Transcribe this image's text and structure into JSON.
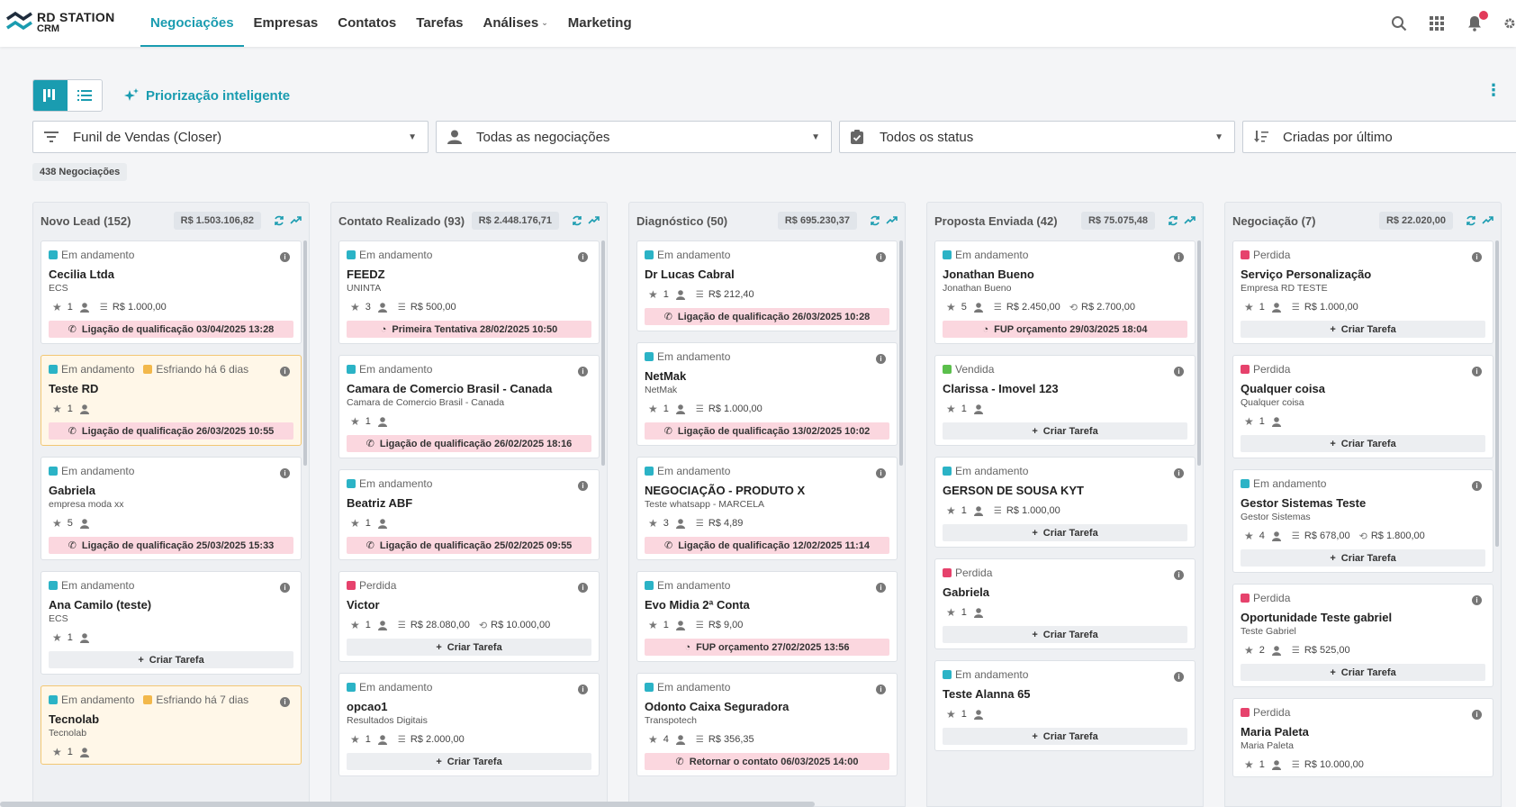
{
  "brand": {
    "line1": "RD STATION",
    "line2": "CRM"
  },
  "nav": [
    "Negociações",
    "Empresas",
    "Contatos",
    "Tarefas",
    "Análises",
    "Marketing"
  ],
  "smart_label": "Priorização inteligente",
  "filters": {
    "funnel": "Funil de Vendas (Closer)",
    "owner": "Todas as negociações",
    "status": "Todos os status",
    "sort": "Criadas por último"
  },
  "deal_count": "438 Negociações",
  "create_task": "Criar Tarefa",
  "columns": [
    {
      "title": "Novo Lead (152)",
      "value": "R$ 1.503.106,82",
      "cards": [
        {
          "status": "Em andamento",
          "color": "blue",
          "name": "Cecilia Ltda",
          "sub": "ECS",
          "stars": "1",
          "amount": "R$ 1.000,00",
          "task": "Ligação de qualificação 03/04/2025 13:28",
          "task_type": "phone"
        },
        {
          "status": "Em andamento",
          "color": "blue",
          "extra": "Esfriando há 6 dias",
          "warm": true,
          "name": "Teste RD",
          "sub": "",
          "stars": "1",
          "task": "Ligação de qualificação 26/03/2025 10:55",
          "task_type": "phone"
        },
        {
          "status": "Em andamento",
          "color": "blue",
          "name": "Gabriela",
          "sub": "empresa moda xx",
          "stars": "5",
          "task": "Ligação de qualificação 25/03/2025 15:33",
          "task_type": "phone"
        },
        {
          "status": "Em andamento",
          "color": "blue",
          "name": "Ana Camilo (teste)",
          "sub": "ECS",
          "stars": "1",
          "task": "",
          "task_type": "create"
        },
        {
          "status": "Em andamento",
          "color": "blue",
          "extra": "Esfriando há 7 dias",
          "warm": true,
          "name": "Tecnolab",
          "sub": "Tecnolab",
          "stars": "1",
          "task": "",
          "task_type": "none"
        }
      ]
    },
    {
      "title": "Contato Realizado (93)",
      "value": "R$ 2.448.176,71",
      "cards": [
        {
          "status": "Em andamento",
          "color": "blue",
          "name": "FEEDZ",
          "sub": "UNINTA",
          "stars": "3",
          "amount": "R$ 500,00",
          "task": "Primeira Tentativa 28/02/2025 10:50",
          "task_type": "whatsapp"
        },
        {
          "status": "Em andamento",
          "color": "blue",
          "name": "Camara de Comercio Brasil - Canada",
          "sub": "Camara de Comercio Brasil - Canada",
          "stars": "1",
          "task": "Ligação de qualificação 26/02/2025 18:16",
          "task_type": "phone"
        },
        {
          "status": "Em andamento",
          "color": "blue",
          "name": "Beatriz ABF",
          "sub": "",
          "stars": "1",
          "task": "Ligação de qualificação 25/02/2025 09:55",
          "task_type": "phone"
        },
        {
          "status": "Perdida",
          "color": "red",
          "name": "Victor",
          "sub": "",
          "stars": "1",
          "amount": "R$ 28.080,00",
          "recurring": "R$ 10.000,00",
          "task": "",
          "task_type": "create"
        },
        {
          "status": "Em andamento",
          "color": "blue",
          "name": "opcao1",
          "sub": "Resultados Digitais",
          "stars": "1",
          "amount": "R$ 2.000,00",
          "task": "",
          "task_type": "create"
        }
      ]
    },
    {
      "title": "Diagnóstico (50)",
      "value": "R$ 695.230,37",
      "cards": [
        {
          "status": "Em andamento",
          "color": "blue",
          "name": "Dr Lucas Cabral",
          "sub": "",
          "stars": "1",
          "amount": "R$ 212,40",
          "task": "Ligação de qualificação 26/03/2025 10:28",
          "task_type": "phone"
        },
        {
          "status": "Em andamento",
          "color": "blue",
          "name": "NetMak",
          "sub": "NetMak",
          "stars": "1",
          "amount": "R$ 1.000,00",
          "task": "Ligação de qualificação 13/02/2025 10:02",
          "task_type": "phone"
        },
        {
          "status": "Em andamento",
          "color": "blue",
          "name": "NEGOCIAÇÃO - PRODUTO X",
          "sub": "Teste whatsapp - MARCELA",
          "stars": "3",
          "amount": "R$ 4,89",
          "task": "Ligação de qualificação 12/02/2025 11:14",
          "task_type": "phone"
        },
        {
          "status": "Em andamento",
          "color": "blue",
          "name": "Evo Midia 2ª Conta",
          "sub": "",
          "stars": "1",
          "amount": "R$ 9,00",
          "task": "FUP orçamento 27/02/2025 13:56",
          "task_type": "whatsapp"
        },
        {
          "status": "Em andamento",
          "color": "blue",
          "name": "Odonto Caixa Seguradora",
          "sub": "Transpotech",
          "stars": "4",
          "amount": "R$ 356,35",
          "task": "Retornar o contato 06/03/2025 14:00",
          "task_type": "phone"
        }
      ]
    },
    {
      "title": "Proposta Enviada (42)",
      "value": "R$ 75.075,48",
      "cards": [
        {
          "status": "Em andamento",
          "color": "blue",
          "name": "Jonathan Bueno",
          "sub": "Jonathan Bueno",
          "stars": "5",
          "amount": "R$ 2.450,00",
          "recurring": "R$ 2.700,00",
          "task": "FUP orçamento 29/03/2025 18:04",
          "task_type": "whatsapp"
        },
        {
          "status": "Vendida",
          "color": "green",
          "name": "Clarissa - Imovel 123",
          "sub": "",
          "stars": "1",
          "task": "",
          "task_type": "create"
        },
        {
          "status": "Em andamento",
          "color": "blue",
          "name": "GERSON DE SOUSA KYT",
          "sub": "",
          "stars": "1",
          "amount": "R$ 1.000,00",
          "task": "",
          "task_type": "create"
        },
        {
          "status": "Perdida",
          "color": "red",
          "name": "Gabriela",
          "sub": "",
          "stars": "1",
          "task": "",
          "task_type": "create"
        },
        {
          "status": "Em andamento",
          "color": "blue",
          "name": "Teste Alanna 65",
          "sub": "",
          "stars": "1",
          "task": "",
          "task_type": "create"
        }
      ]
    },
    {
      "title": "Negociação (7)",
      "value": "R$ 22.020,00",
      "cards": [
        {
          "status": "Perdida",
          "color": "red",
          "name": "Serviço Personalização",
          "sub": "Empresa RD TESTE",
          "stars": "1",
          "amount": "R$ 1.000,00",
          "task": "",
          "task_type": "create"
        },
        {
          "status": "Perdida",
          "color": "red",
          "name": "Qualquer coisa",
          "sub": "Qualquer coisa",
          "stars": "1",
          "task": "",
          "task_type": "create"
        },
        {
          "status": "Em andamento",
          "color": "blue",
          "name": "Gestor Sistemas Teste",
          "sub": "Gestor Sistemas",
          "stars": "4",
          "amount": "R$ 678,00",
          "recurring": "R$ 1.800,00",
          "task": "",
          "task_type": "create"
        },
        {
          "status": "Perdida",
          "color": "red",
          "name": "Oportunidade Teste gabriel",
          "sub": "Teste Gabriel",
          "stars": "2",
          "amount": "R$ 525,00",
          "task": "",
          "task_type": "create"
        },
        {
          "status": "Perdida",
          "color": "red",
          "name": "Maria Paleta",
          "sub": "Maria Paleta",
          "stars": "1",
          "amount": "R$ 10.000,00",
          "task": "",
          "task_type": "none"
        }
      ]
    }
  ]
}
